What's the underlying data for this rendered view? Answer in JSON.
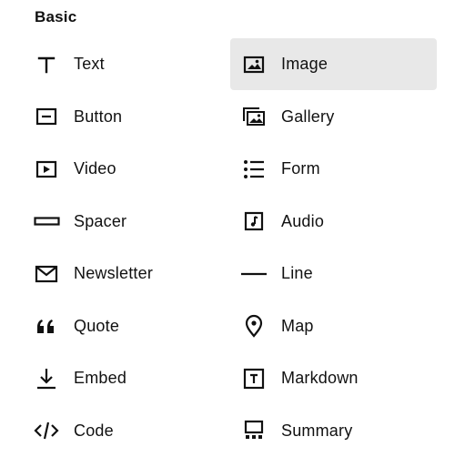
{
  "section": {
    "title": "Basic"
  },
  "colors": {
    "selected_bg": "#e8e8e8",
    "text": "#111111"
  },
  "items": [
    {
      "label": "Text",
      "icon": "text-icon"
    },
    {
      "label": "Image",
      "icon": "image-icon",
      "selected": true
    },
    {
      "label": "Button",
      "icon": "button-icon"
    },
    {
      "label": "Gallery",
      "icon": "gallery-icon"
    },
    {
      "label": "Video",
      "icon": "video-icon"
    },
    {
      "label": "Form",
      "icon": "form-icon"
    },
    {
      "label": "Spacer",
      "icon": "spacer-icon"
    },
    {
      "label": "Audio",
      "icon": "audio-icon"
    },
    {
      "label": "Newsletter",
      "icon": "newsletter-icon"
    },
    {
      "label": "Line",
      "icon": "line-icon"
    },
    {
      "label": "Quote",
      "icon": "quote-icon"
    },
    {
      "label": "Map",
      "icon": "map-pin-icon"
    },
    {
      "label": "Embed",
      "icon": "embed-icon"
    },
    {
      "label": "Markdown",
      "icon": "markdown-icon"
    },
    {
      "label": "Code",
      "icon": "code-icon"
    },
    {
      "label": "Summary",
      "icon": "summary-icon"
    }
  ]
}
